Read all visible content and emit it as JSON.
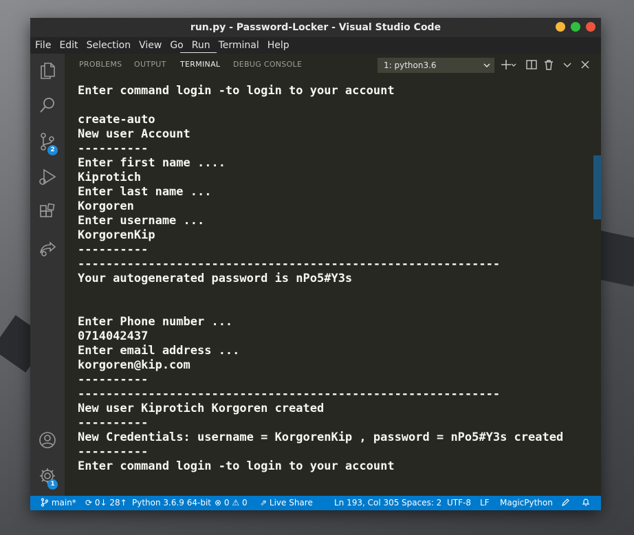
{
  "window": {
    "title": "run.py - Password-Locker - Visual Studio Code"
  },
  "menu": [
    "File",
    "Edit",
    "Selection",
    "View",
    "Go",
    "Run",
    "Terminal",
    "Help"
  ],
  "activity_bar": {
    "icons": [
      "explorer-icon",
      "search-icon",
      "source-control-icon",
      "run-debug-icon",
      "extensions-icon",
      "live-share-icon",
      "account-icon",
      "settings-icon"
    ],
    "scm_badge": "2",
    "settings_badge": "1"
  },
  "panel": {
    "tabs": [
      "PROBLEMS",
      "OUTPUT",
      "TERMINAL",
      "DEBUG CONSOLE"
    ],
    "active_tab": "TERMINAL",
    "terminal_select": "1: python3.6"
  },
  "terminal": {
    "lines": [
      "Enter command login -to login to your account",
      "",
      "create-auto",
      "New user Account",
      "----------",
      "Enter first name ....",
      "Kiprotich",
      "Enter last name ...",
      "Korgoren",
      "Enter username ...",
      "KorgorenKip",
      "----------",
      "------------------------------------------------------------",
      "Your autogenerated password is nPo5#Y3s",
      "",
      "",
      "Enter Phone number ...",
      "0714042437",
      "Enter email address ...",
      "korgoren@kip.com",
      "----------",
      "------------------------------------------------------------",
      "New user Kiprotich Korgoren created",
      "----------",
      "New Credentials: username = KorgorenKip , password = nPo5#Y3s created",
      "----------",
      "Enter command login -to login to your account"
    ]
  },
  "status_bar": {
    "branch": "main*",
    "sync": "0↓ 28↑",
    "interpreter": "Python 3.6.9 64-bit",
    "errors": "0",
    "warnings": "0",
    "live_share": "Live Share",
    "position": "Ln 193, Col 305",
    "spaces": "Spaces: 2",
    "encoding": "UTF-8",
    "eol": "LF",
    "language": "MagicPython"
  },
  "colors": {
    "accent": "#007acc",
    "terminal_bg": "#272822",
    "terminal_fg": "#f8f8f2"
  }
}
